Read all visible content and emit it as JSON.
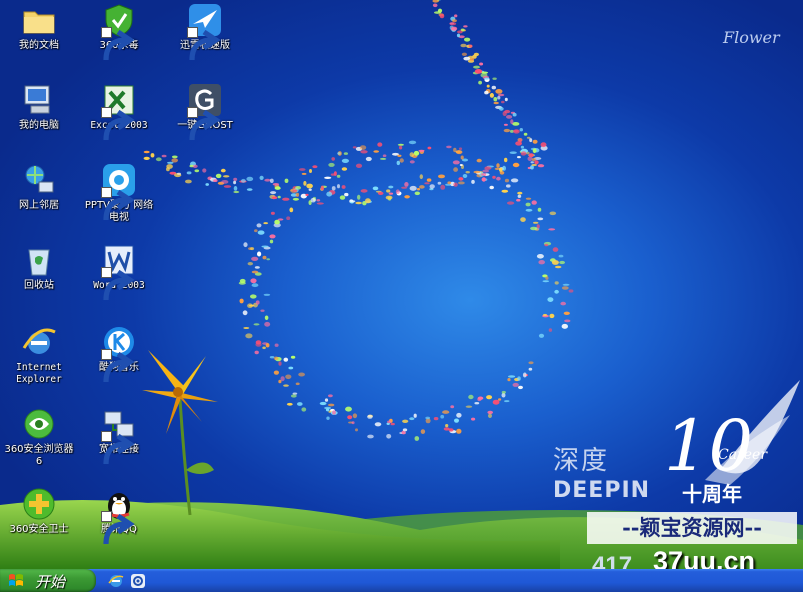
{
  "desktop": {
    "icons": [
      {
        "label": "我的文档",
        "name": "my-documents",
        "icon": "folder-icon"
      },
      {
        "label": "360杀毒",
        "name": "360-antivirus",
        "icon": "shield-icon"
      },
      {
        "label": "迅雷极速版",
        "name": "thunder-speed",
        "icon": "bird-icon"
      },
      {
        "label": "我的电脑",
        "name": "my-computer",
        "icon": "computer-icon"
      },
      {
        "label": "Excel 2003",
        "name": "excel-2003",
        "icon": "excel-icon"
      },
      {
        "label": "一键GHOST",
        "name": "onekey-ghost",
        "icon": "ghost-icon"
      },
      {
        "label": "网上邻居",
        "name": "network-places",
        "icon": "network-icon"
      },
      {
        "label": "PPTV聚力 网络电视",
        "name": "pptv",
        "icon": "pptv-icon"
      },
      {
        "label": "回收站",
        "name": "recycle-bin",
        "icon": "recycle-bin-icon"
      },
      {
        "label": "Word 2003",
        "name": "word-2003",
        "icon": "word-icon"
      },
      {
        "label": "Internet Explorer",
        "name": "internet-explorer",
        "icon": "ie-icon"
      },
      {
        "label": "酷狗音乐",
        "name": "kugou-music",
        "icon": "kugou-icon"
      },
      {
        "label": "360安全浏览器6",
        "name": "360-browser",
        "icon": "browser-icon"
      },
      {
        "label": "宽带连接",
        "name": "broadband-connection",
        "icon": "broadband-icon"
      },
      {
        "label": "360安全卫士",
        "name": "360-security",
        "icon": "plus-shield-icon"
      },
      {
        "label": "腾讯QQ",
        "name": "tencent-qq",
        "icon": "penguin-icon"
      }
    ]
  },
  "wallpaper": {
    "signature": "Flower",
    "brand_cn": "深度",
    "brand_en": "DEEPIN",
    "anniversary_mark": "10",
    "anniversary_word": "Career",
    "anniversary_cn": "十周年"
  },
  "watermark": {
    "site_name": "--颖宝资源网--",
    "url": "37uu.cn",
    "number": "417"
  },
  "taskbar": {
    "start_label": "开始",
    "quick_launch": [
      "ie-icon",
      "media-icon"
    ]
  },
  "colors": {
    "taskbar_blue": "#245edb",
    "start_green": "#3c9a34",
    "desktop_blue": "#1a5fce"
  }
}
